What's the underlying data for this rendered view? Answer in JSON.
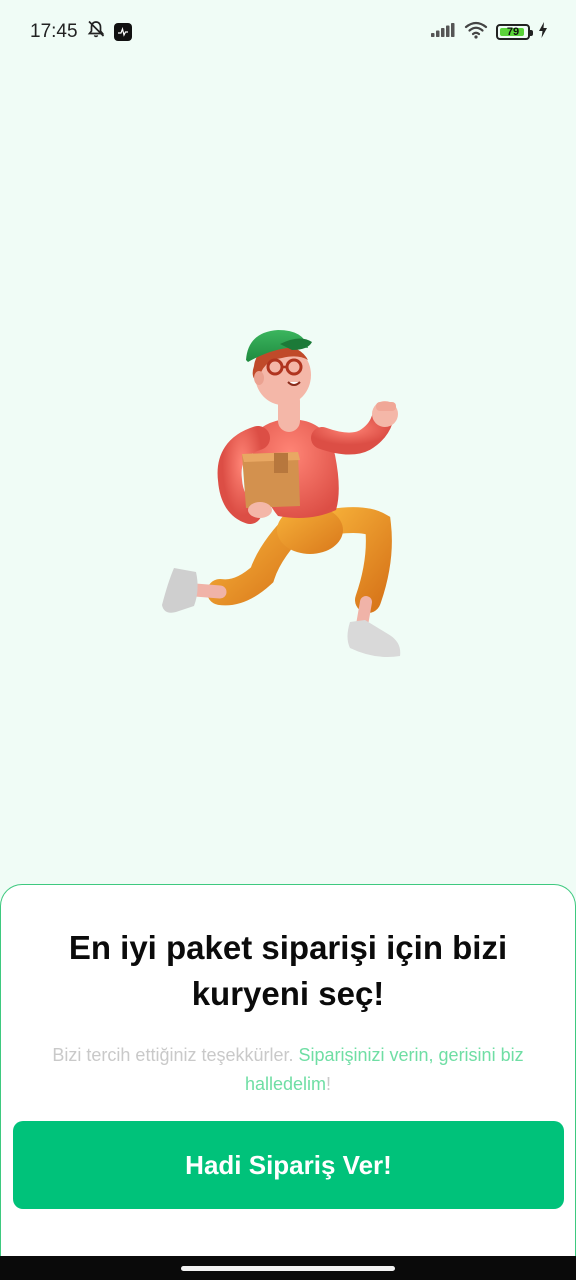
{
  "status_bar": {
    "time": "17:45",
    "battery_level": "79",
    "battery_fraction": 0.79,
    "icons": [
      "notifications-off-icon",
      "app-badge-icon",
      "signal-icon",
      "wifi-icon",
      "battery-icon",
      "charging-icon"
    ]
  },
  "illustration": {
    "name": "courier-running-with-package"
  },
  "sheet": {
    "title": "En iyi paket siparişi için bizi kuryeni seç!",
    "subtitle_muted": "Bizi tercih ettiğiniz teşekkürler. ",
    "subtitle_accent": "Siparişinizi verin, gerisini biz halledelim",
    "subtitle_end": "!",
    "button_label": "Hadi Sipariş Ver!"
  },
  "colors": {
    "background": "#f0fcf6",
    "accent": "#00c27a",
    "accent_light": "#6fdea4",
    "muted_text": "#c9c9c9"
  }
}
